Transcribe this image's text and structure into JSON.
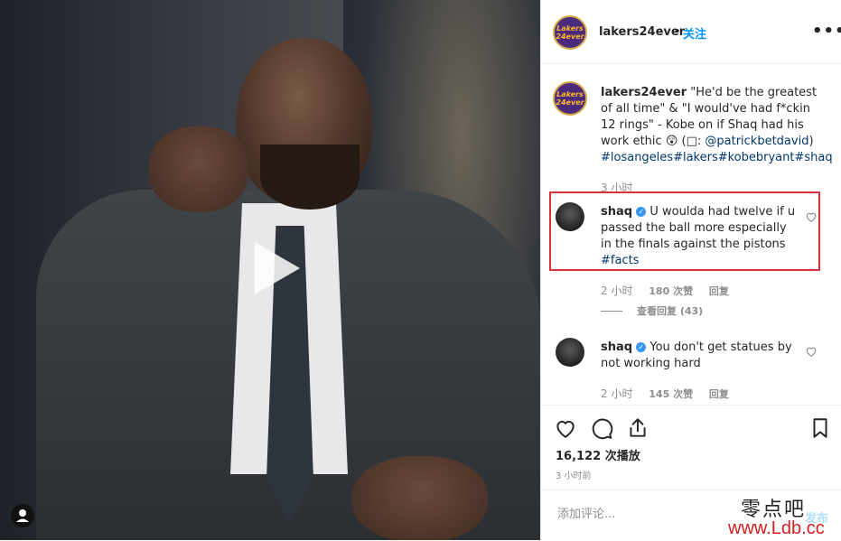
{
  "post": {
    "username": "lakers24ever",
    "follow_label": "关注",
    "more_label": "•••",
    "logo_text": "Lakers 24ever",
    "caption": {
      "author": "lakers24ever",
      "text": "\"He'd be the greatest of all time\" & \"I would've had f*ckin 12 rings\" - Kobe on if Shaq had his work ethic 😲 (□: ",
      "mention": "@patrickbetdavid",
      "close_paren": ")",
      "hashtags": "#losangeles#lakers#kobebryant#shaq",
      "time": "3 小时"
    }
  },
  "comments": [
    {
      "author": "shaq",
      "verified": true,
      "text": "U woulda had twelve if u passed the ball more especially in the finals against the pistons ",
      "hashtag": "#facts",
      "time": "2 小时",
      "likes": "180 次赞",
      "reply_label": "回复",
      "view_replies": "查看回复 (43)"
    },
    {
      "author": "shaq",
      "verified": true,
      "text": "You don't get statues by not working hard",
      "time": "2 小时",
      "likes": "145 次赞",
      "reply_label": "回复"
    }
  ],
  "stats": {
    "views": "16,122 次播放",
    "posted": "3 小时前"
  },
  "add_comment": {
    "placeholder": "添加评论...",
    "post_label": "发布"
  },
  "watermark": {
    "line1": "零点吧",
    "line2": "www.Ldb.cc"
  },
  "icons": {
    "like": "heart-icon",
    "comment": "comment-icon",
    "share": "share-icon",
    "save": "bookmark-icon",
    "play": "play-icon"
  },
  "colors": {
    "link": "#00376b",
    "follow": "#0095f6",
    "highlight_box": "#d9323a",
    "verified": "#3897f0"
  }
}
